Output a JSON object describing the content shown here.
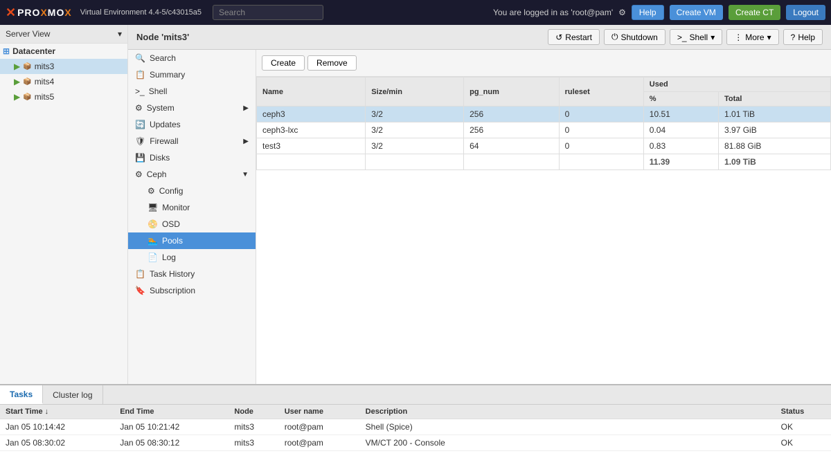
{
  "navbar": {
    "brand": {
      "x": "X",
      "prox": "PRO",
      "mox": "XMO",
      "full": "PROXMOX"
    },
    "version": "Virtual Environment 4.4-5/c43015a5",
    "search_placeholder": "Search",
    "user_label": "You are logged in as 'root@pam'",
    "help_label": "Help",
    "create_vm_label": "Create VM",
    "create_ct_label": "Create CT",
    "logout_label": "Logout"
  },
  "sidebar": {
    "view_label": "Server View",
    "datacenter_label": "Datacenter",
    "nodes": [
      {
        "id": "mits3",
        "label": "mits3",
        "selected": true
      },
      {
        "id": "mits4",
        "label": "mits4"
      },
      {
        "id": "mits5",
        "label": "mits5"
      }
    ]
  },
  "content": {
    "node_title": "Node 'mits3'",
    "restart_btn": "Restart",
    "shutdown_btn": "Shutdown",
    "shell_btn": "Shell",
    "more_btn": "More",
    "help_btn": "Help"
  },
  "nav": {
    "items": [
      {
        "id": "search",
        "label": "Search",
        "icon": "search"
      },
      {
        "id": "summary",
        "label": "Summary",
        "icon": "summary"
      },
      {
        "id": "shell",
        "label": "Shell",
        "icon": "shell"
      },
      {
        "id": "system",
        "label": "System",
        "icon": "system",
        "has_arrow": true
      },
      {
        "id": "updates",
        "label": "Updates",
        "icon": "updates"
      },
      {
        "id": "firewall",
        "label": "Firewall",
        "icon": "firewall",
        "has_arrow": true
      },
      {
        "id": "disks",
        "label": "Disks",
        "icon": "disks"
      },
      {
        "id": "ceph",
        "label": "Ceph",
        "icon": "ceph",
        "has_arrow": true,
        "expanded": true
      },
      {
        "id": "config",
        "label": "Config",
        "icon": "config",
        "sub": true
      },
      {
        "id": "monitor",
        "label": "Monitor",
        "icon": "monitor",
        "sub": true
      },
      {
        "id": "osd",
        "label": "OSD",
        "icon": "osd",
        "sub": true
      },
      {
        "id": "pools",
        "label": "Pools",
        "icon": "pools",
        "sub": true,
        "active": true
      },
      {
        "id": "log",
        "label": "Log",
        "icon": "log",
        "sub": true
      },
      {
        "id": "task_history",
        "label": "Task History",
        "icon": "task_history"
      },
      {
        "id": "subscription",
        "label": "Subscription",
        "icon": "subscription"
      }
    ]
  },
  "toolbar": {
    "create_btn": "Create",
    "remove_btn": "Remove"
  },
  "table": {
    "columns": [
      {
        "id": "name",
        "label": "Name"
      },
      {
        "id": "size_min",
        "label": "Size/min"
      },
      {
        "id": "pg_num",
        "label": "pg_num"
      },
      {
        "id": "ruleset",
        "label": "ruleset"
      },
      {
        "id": "used_pct",
        "label": "%"
      },
      {
        "id": "used_total",
        "label": "Total"
      }
    ],
    "used_header": "Used",
    "rows": [
      {
        "name": "ceph3",
        "size_min": "3/2",
        "pg_num": "256",
        "ruleset": "0",
        "pct": "10.51",
        "total": "1.01 TiB",
        "selected": true
      },
      {
        "name": "ceph3-lxc",
        "size_min": "3/2",
        "pg_num": "256",
        "ruleset": "0",
        "pct": "0.04",
        "total": "3.97 GiB"
      },
      {
        "name": "test3",
        "size_min": "3/2",
        "pg_num": "64",
        "ruleset": "0",
        "pct": "0.83",
        "total": "81.88 GiB"
      }
    ],
    "totals": {
      "pct": "11.39",
      "total": "1.09 TiB"
    }
  },
  "bottom": {
    "tabs": [
      {
        "id": "tasks",
        "label": "Tasks",
        "active": true
      },
      {
        "id": "cluster_log",
        "label": "Cluster log"
      }
    ],
    "columns": [
      {
        "id": "start_time",
        "label": "Start Time ↓"
      },
      {
        "id": "end_time",
        "label": "End Time"
      },
      {
        "id": "node",
        "label": "Node"
      },
      {
        "id": "user_name",
        "label": "User name"
      },
      {
        "id": "description",
        "label": "Description"
      },
      {
        "id": "status",
        "label": "Status"
      }
    ],
    "rows": [
      {
        "start_time": "Jan 05 10:14:42",
        "end_time": "Jan 05 10:21:42",
        "node": "mits3",
        "user_name": "root@pam",
        "description": "Shell (Spice)",
        "status": "OK"
      },
      {
        "start_time": "Jan 05 08:30:02",
        "end_time": "Jan 05 08:30:12",
        "node": "mits3",
        "user_name": "root@pam",
        "description": "VM/CT 200 - Console",
        "status": "OK"
      }
    ]
  }
}
